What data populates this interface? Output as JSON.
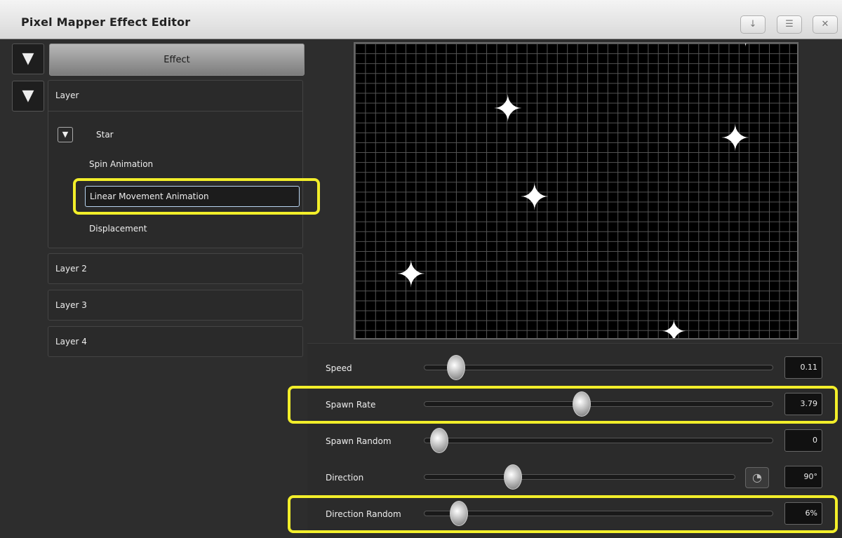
{
  "window": {
    "title": "Pixel Mapper Effect Editor",
    "buttons": {
      "minimize": "↓",
      "menu": "☰",
      "close": "✕"
    }
  },
  "left_panel": {
    "effect_button": "Effect",
    "layer_header": "Layer",
    "star_label": "Star",
    "items": {
      "spin": "Spin Animation",
      "linear": "Linear Movement Animation",
      "displacement": "Displacement"
    },
    "layers": [
      "Layer 2",
      "Layer 3",
      "Layer 4"
    ]
  },
  "controls": {
    "speed": {
      "label": "Speed",
      "value": "0.11",
      "position": 0.05
    },
    "spawn_rate": {
      "label": "Spawn Rate",
      "value": "3.79",
      "position": 0.43
    },
    "spawn_random": {
      "label": "Spawn Random",
      "value": "0",
      "position": 0.0
    },
    "direction": {
      "label": "Direction",
      "value": "90°",
      "position": 0.25
    },
    "direction_random": {
      "label": "Direction Random",
      "value": "6%",
      "position": 0.06
    }
  },
  "colors": {
    "highlight": "#f2ee2a",
    "selection_border": "#b8d4f0"
  }
}
